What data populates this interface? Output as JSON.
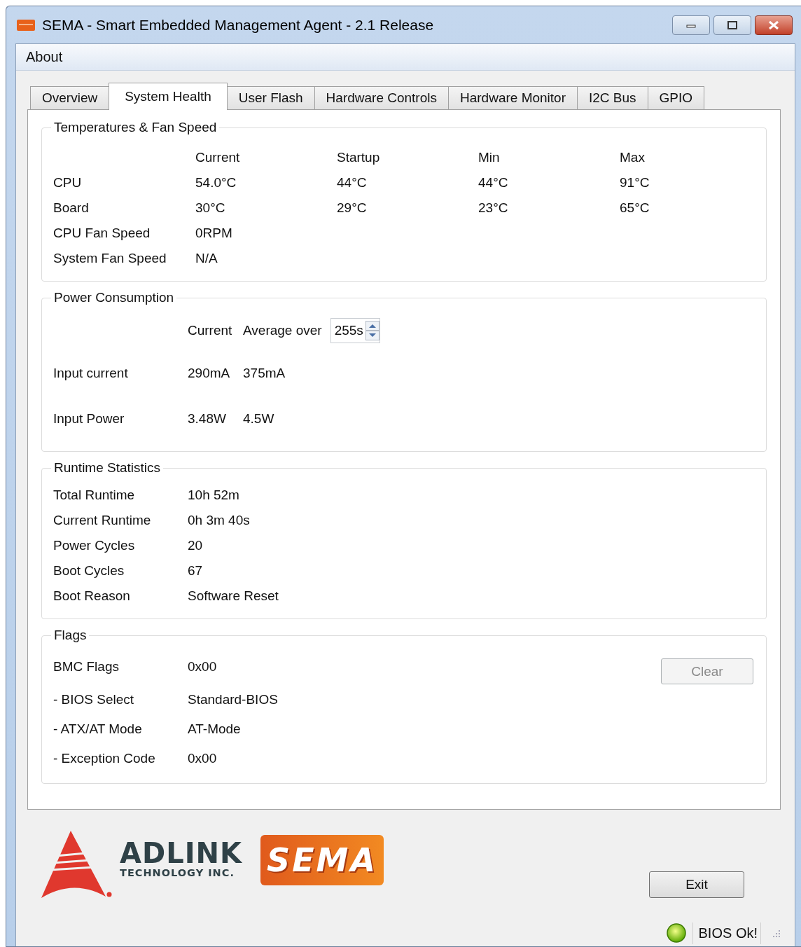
{
  "window": {
    "title": "SEMA - Smart Embedded Management Agent - 2.1 Release"
  },
  "menu": [
    "About"
  ],
  "tabs": [
    {
      "label": "Overview",
      "selected": false
    },
    {
      "label": "System Health",
      "selected": true
    },
    {
      "label": "User Flash",
      "selected": false
    },
    {
      "label": "Hardware Controls",
      "selected": false
    },
    {
      "label": "Hardware Monitor",
      "selected": false
    },
    {
      "label": "I2C Bus",
      "selected": false
    },
    {
      "label": "GPIO",
      "selected": false
    }
  ],
  "temperatures": {
    "title": "Temperatures & Fan Speed",
    "columns": [
      "Current",
      "Startup",
      "Min",
      "Max"
    ],
    "rows": [
      {
        "label": "CPU",
        "values": [
          "54.0°C",
          "44°C",
          "44°C",
          "91°C"
        ]
      },
      {
        "label": "Board",
        "values": [
          "30°C",
          "29°C",
          "23°C",
          "65°C"
        ]
      },
      {
        "label": "CPU Fan Speed",
        "values": [
          "0RPM"
        ]
      },
      {
        "label": "System Fan Speed",
        "values": [
          "N/A"
        ]
      }
    ]
  },
  "power": {
    "title": "Power Consumption",
    "columns": [
      "Current",
      "Average over"
    ],
    "average_window": "255s",
    "rows": [
      {
        "label": "Input current",
        "values": [
          "290mA",
          "375mA"
        ]
      },
      {
        "label": "Input Power",
        "values": [
          "3.48W",
          "4.5W"
        ]
      }
    ]
  },
  "runtime": {
    "title": "Runtime Statistics",
    "rows": [
      {
        "label": "Total Runtime",
        "value": "10h 52m"
      },
      {
        "label": "Current Runtime",
        "value": "0h 3m 40s"
      },
      {
        "label": "Power Cycles",
        "value": "20"
      },
      {
        "label": "Boot Cycles",
        "value": "67"
      },
      {
        "label": "Boot Reason",
        "value": "Software Reset"
      }
    ]
  },
  "flags": {
    "title": "Flags",
    "clear_button": {
      "label": "Clear",
      "disabled": true
    },
    "rows": [
      {
        "label": "BMC Flags",
        "value": "0x00"
      },
      {
        "label": "- BIOS Select",
        "value": "Standard-BIOS"
      },
      {
        "label": "- ATX/AT Mode",
        "value": "AT-Mode"
      },
      {
        "label": "- Exception Code",
        "value": "0x00"
      }
    ]
  },
  "logos": {
    "adlink": "ADLINK",
    "adlink_tagline": "TECHNOLOGY INC.",
    "sema": "SEMA"
  },
  "exit_button": {
    "label": "Exit"
  },
  "status": {
    "bios_ok": true,
    "text": "BIOS Ok!"
  }
}
